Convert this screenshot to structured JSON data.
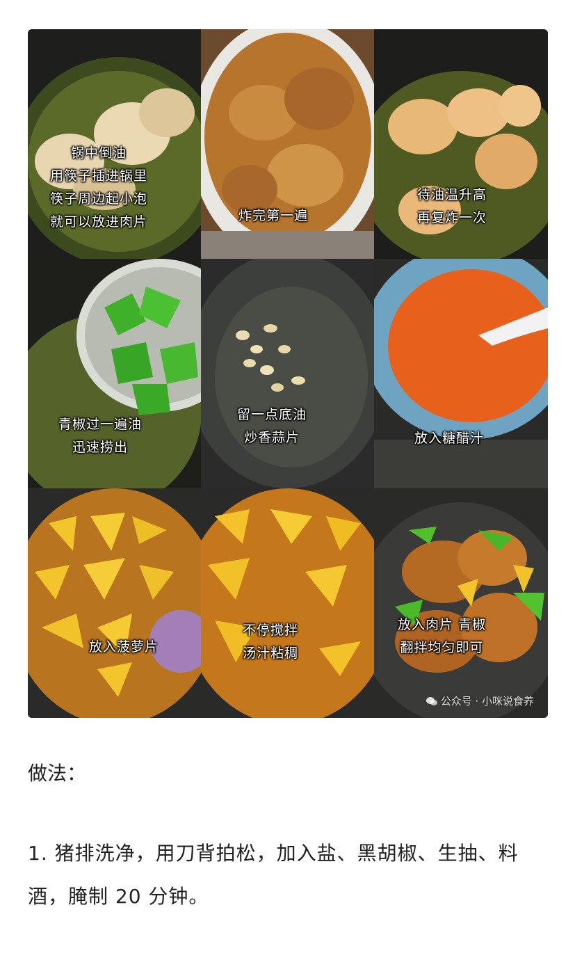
{
  "panels": [
    {
      "caption": "锅中倒油\n用筷子插进锅里\n筷子周边起小泡\n就可以放进肉片",
      "icon": "frying-pork-pan"
    },
    {
      "caption": "炸完第一遍",
      "icon": "fried-pork-plate"
    },
    {
      "caption": "待油温升高\n再复炸一次",
      "icon": "refrying-pork-pan"
    },
    {
      "caption": "青椒过一遍油\n迅速捞出",
      "icon": "green-pepper-strainer"
    },
    {
      "caption": "留一点底油\n炒香蒜片",
      "icon": "garlic-pan"
    },
    {
      "caption": "放入糖醋汁",
      "icon": "sweet-sour-sauce-bowl"
    },
    {
      "caption": "放入菠萝片",
      "icon": "pineapple-pan"
    },
    {
      "caption": "不停搅拌\n汤汁粘稠",
      "icon": "stirring-sauce-pan"
    },
    {
      "caption": "放入肉片 青椒\n翻拌均匀即可",
      "icon": "finished-dish-pan"
    }
  ],
  "watermark": "公众号 · 小咪说食养",
  "section_title": "做法：",
  "step_1": "1. 猪排洗净，用刀背拍松，加入盐、黑胡椒、生抽、料酒，腌制 20 分钟。"
}
